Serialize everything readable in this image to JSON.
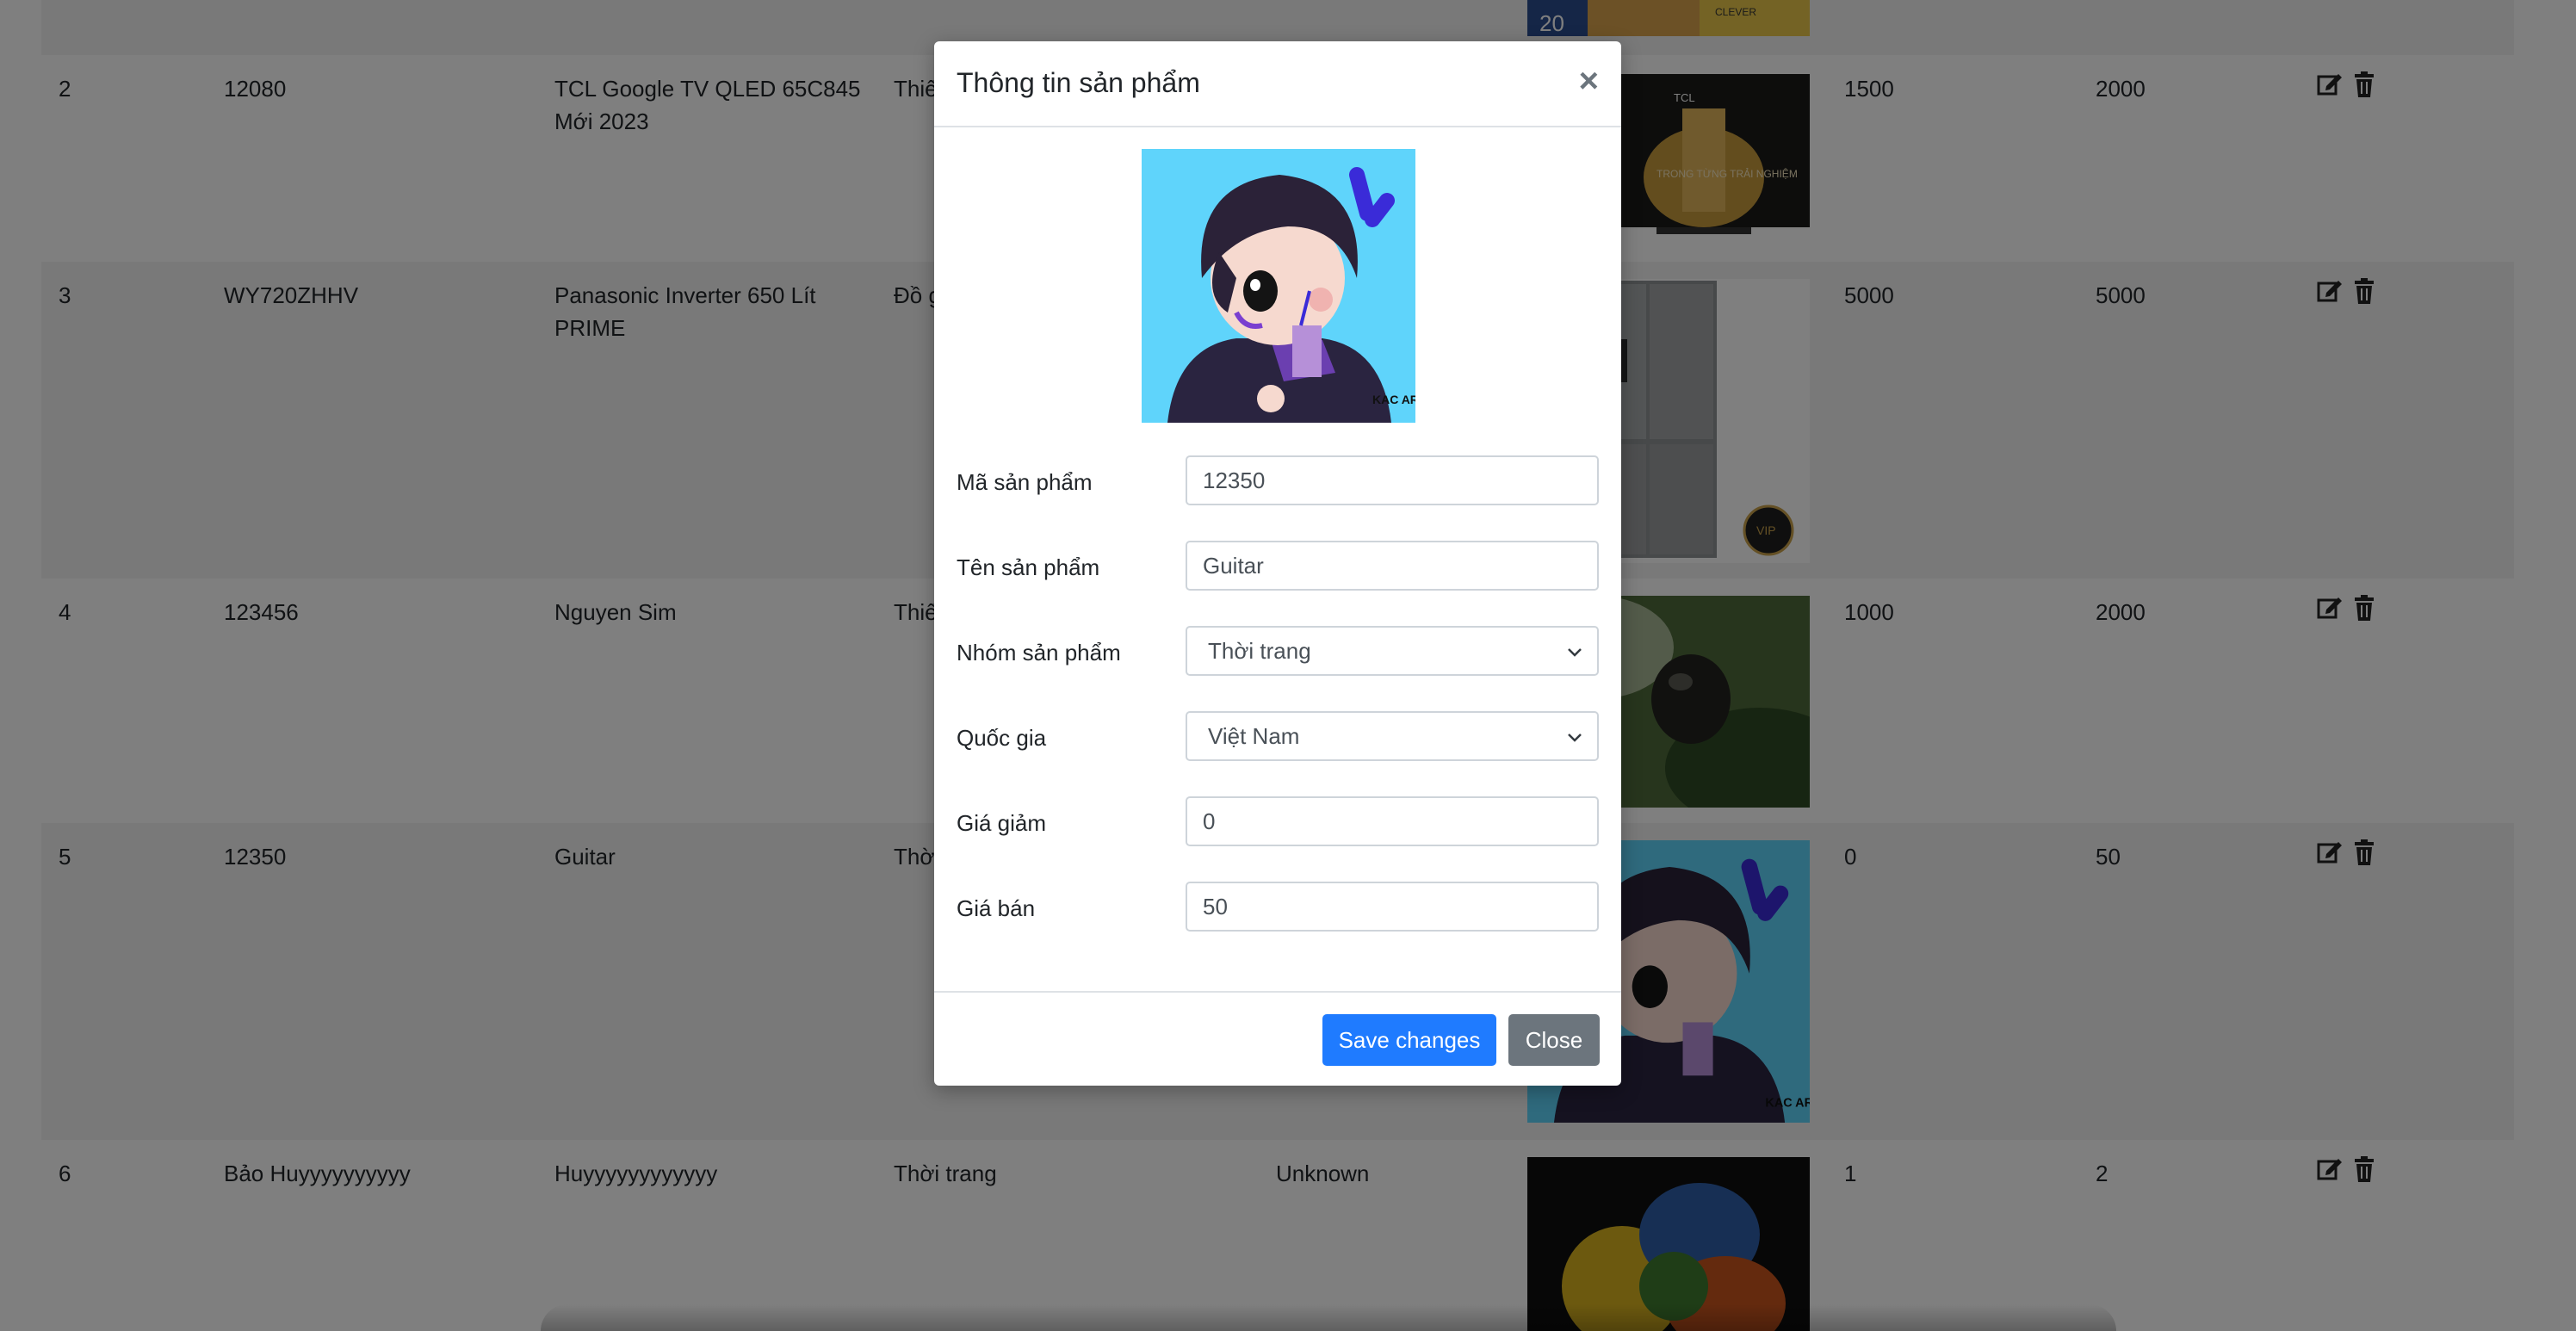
{
  "table": {
    "rows": [
      {
        "no": "2",
        "code": "12080",
        "name": "TCL Google TV QLED 65C845 Mới 2023",
        "group": "Thiế",
        "country": "",
        "discount": "1500",
        "price": "2000",
        "image": "tv-promo-image"
      },
      {
        "no": "3",
        "code": "WY720ZHHV",
        "name": "Panasonic Inverter 650 Lít PRIME",
        "group": "Đồ g",
        "country": "",
        "discount": "5000",
        "price": "5000",
        "image": "fridge-image"
      },
      {
        "no": "4",
        "code": "123456",
        "name": "Nguyen Sim",
        "group": "Thiế",
        "country": "",
        "discount": "1000",
        "price": "2000",
        "image": "fruit-image"
      },
      {
        "no": "5",
        "code": "12350",
        "name": "Guitar",
        "group": "Thờ",
        "country": "",
        "discount": "0",
        "price": "50",
        "image": "avatar-image"
      },
      {
        "no": "6",
        "code": "Bảo Huyyyyyyyyyy",
        "name": "Huyyyyyyyyyyyy",
        "group": "Thời trang",
        "country": "Unknown",
        "discount": "1",
        "price": "2",
        "image": "rose-image"
      }
    ],
    "top_thumb_text": [
      "20",
      "CLEVER"
    ],
    "tv_promo_text": [
      "TCL",
      "TRONG TỪNG TRẢI NGHIỆM"
    ],
    "fridge_badge": "VIP"
  },
  "modal": {
    "title": "Thông tin sản phẩm",
    "close_symbol": "×",
    "image_watermark": "KAC ART",
    "fields": {
      "code": {
        "label": "Mã sản phẩm",
        "value": "12350"
      },
      "name": {
        "label": "Tên sản phẩm",
        "value": "Guitar"
      },
      "group": {
        "label": "Nhóm sản phẩm",
        "value": "Thời trang"
      },
      "country": {
        "label": "Quốc gia",
        "value": "Việt Nam"
      },
      "discount": {
        "label": "Giá giảm",
        "value": "0"
      },
      "price": {
        "label": "Giá bán",
        "value": "50"
      }
    },
    "save_label": "Save changes",
    "close_label": "Close"
  },
  "colors": {
    "primary": "#1f7bff",
    "secondary": "#6c757d",
    "backdrop": "rgba(0,0,0,0.5)",
    "avatar_bg": "#5fd4fb"
  },
  "icons": {
    "edit": "edit-icon",
    "delete": "trash-icon",
    "caret": "chevron-down-icon"
  }
}
